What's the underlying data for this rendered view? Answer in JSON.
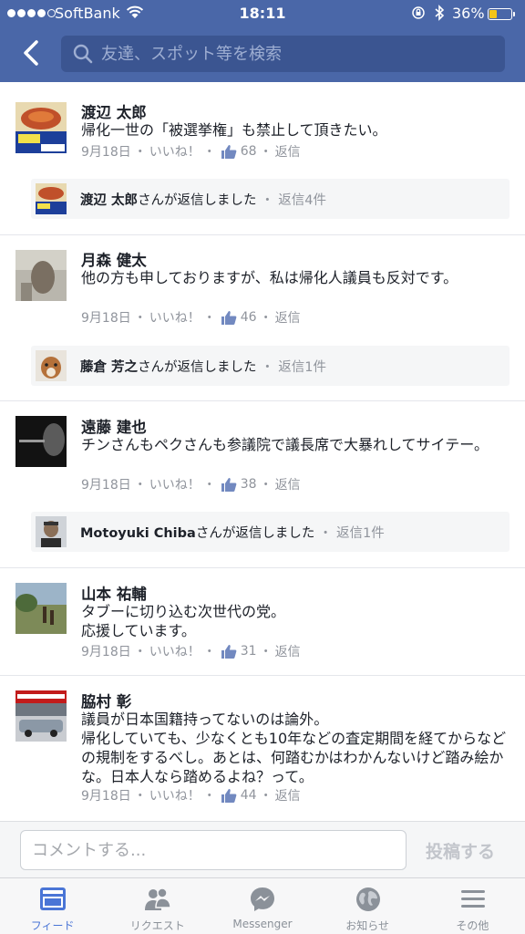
{
  "status_bar": {
    "carrier": "SoftBank",
    "time": "18:11",
    "battery_percent": "36%",
    "battery_level": 0.36,
    "signal_bars_filled": 4,
    "signal_bars_total": 5
  },
  "header": {
    "search_placeholder": "友達、スポット等を検索"
  },
  "comments": [
    {
      "name": "渡辺 太郎",
      "text": "帰化一世の「被選挙権」も禁止して頂きたい。",
      "date": "9月18日",
      "like_label": "いいね！",
      "like_count": "68",
      "reply_label": "返信",
      "reply_summary": {
        "name": "渡辺 太郎",
        "action": "さんが返信しました",
        "count": "返信4件"
      }
    },
    {
      "name": "月森 健太",
      "text": "他の方も申しておりますが、私は帰化人議員も反対です。",
      "date": "9月18日",
      "like_label": "いいね！",
      "like_count": "46",
      "reply_label": "返信",
      "reply_summary": {
        "name": "藤倉 芳之",
        "action": "さんが返信しました",
        "count": "返信1件"
      }
    },
    {
      "name": "遠藤 建也",
      "text": "チンさんもペクさんも参議院で議長席で大暴れしてサイテー。",
      "date": "9月18日",
      "like_label": "いいね！",
      "like_count": "38",
      "reply_label": "返信",
      "reply_summary": {
        "name": "Motoyuki Chiba",
        "action": "さんが返信しました",
        "count": "返信1件"
      }
    },
    {
      "name": "山本 祐輔",
      "text": "タブーに切り込む次世代の党。\n応援しています。",
      "date": "9月18日",
      "like_label": "いいね！",
      "like_count": "31",
      "reply_label": "返信"
    },
    {
      "name": "脇村 彰",
      "text": "議員が日本国籍持ってないのは論外。\n帰化していても、少なくとも10年などの査定期間を経てからなどの規制をするべし。あとは、何踏むかはわかんないけど踏み絵かな。日本人なら踏めるよね？って。",
      "date": "9月18日",
      "like_label": "いいね！",
      "like_count": "44",
      "reply_label": "返信"
    }
  ],
  "composer": {
    "placeholder": "コメントする...",
    "post_label": "投稿する"
  },
  "tabs": [
    {
      "label": "フィード",
      "icon": "news-feed-icon",
      "active": true
    },
    {
      "label": "リクエスト",
      "icon": "friend-requests-icon",
      "active": false
    },
    {
      "label": "Messenger",
      "icon": "messenger-icon",
      "active": false
    },
    {
      "label": "お知らせ",
      "icon": "globe-icon",
      "active": false
    },
    {
      "label": "その他",
      "icon": "menu-icon",
      "active": false
    }
  ],
  "colors": {
    "header_bg": "#4a67a8",
    "search_bg": "#3b5591",
    "active_tab": "#4a75d6",
    "meta_text": "#90949c",
    "battery": "#f5c518"
  }
}
